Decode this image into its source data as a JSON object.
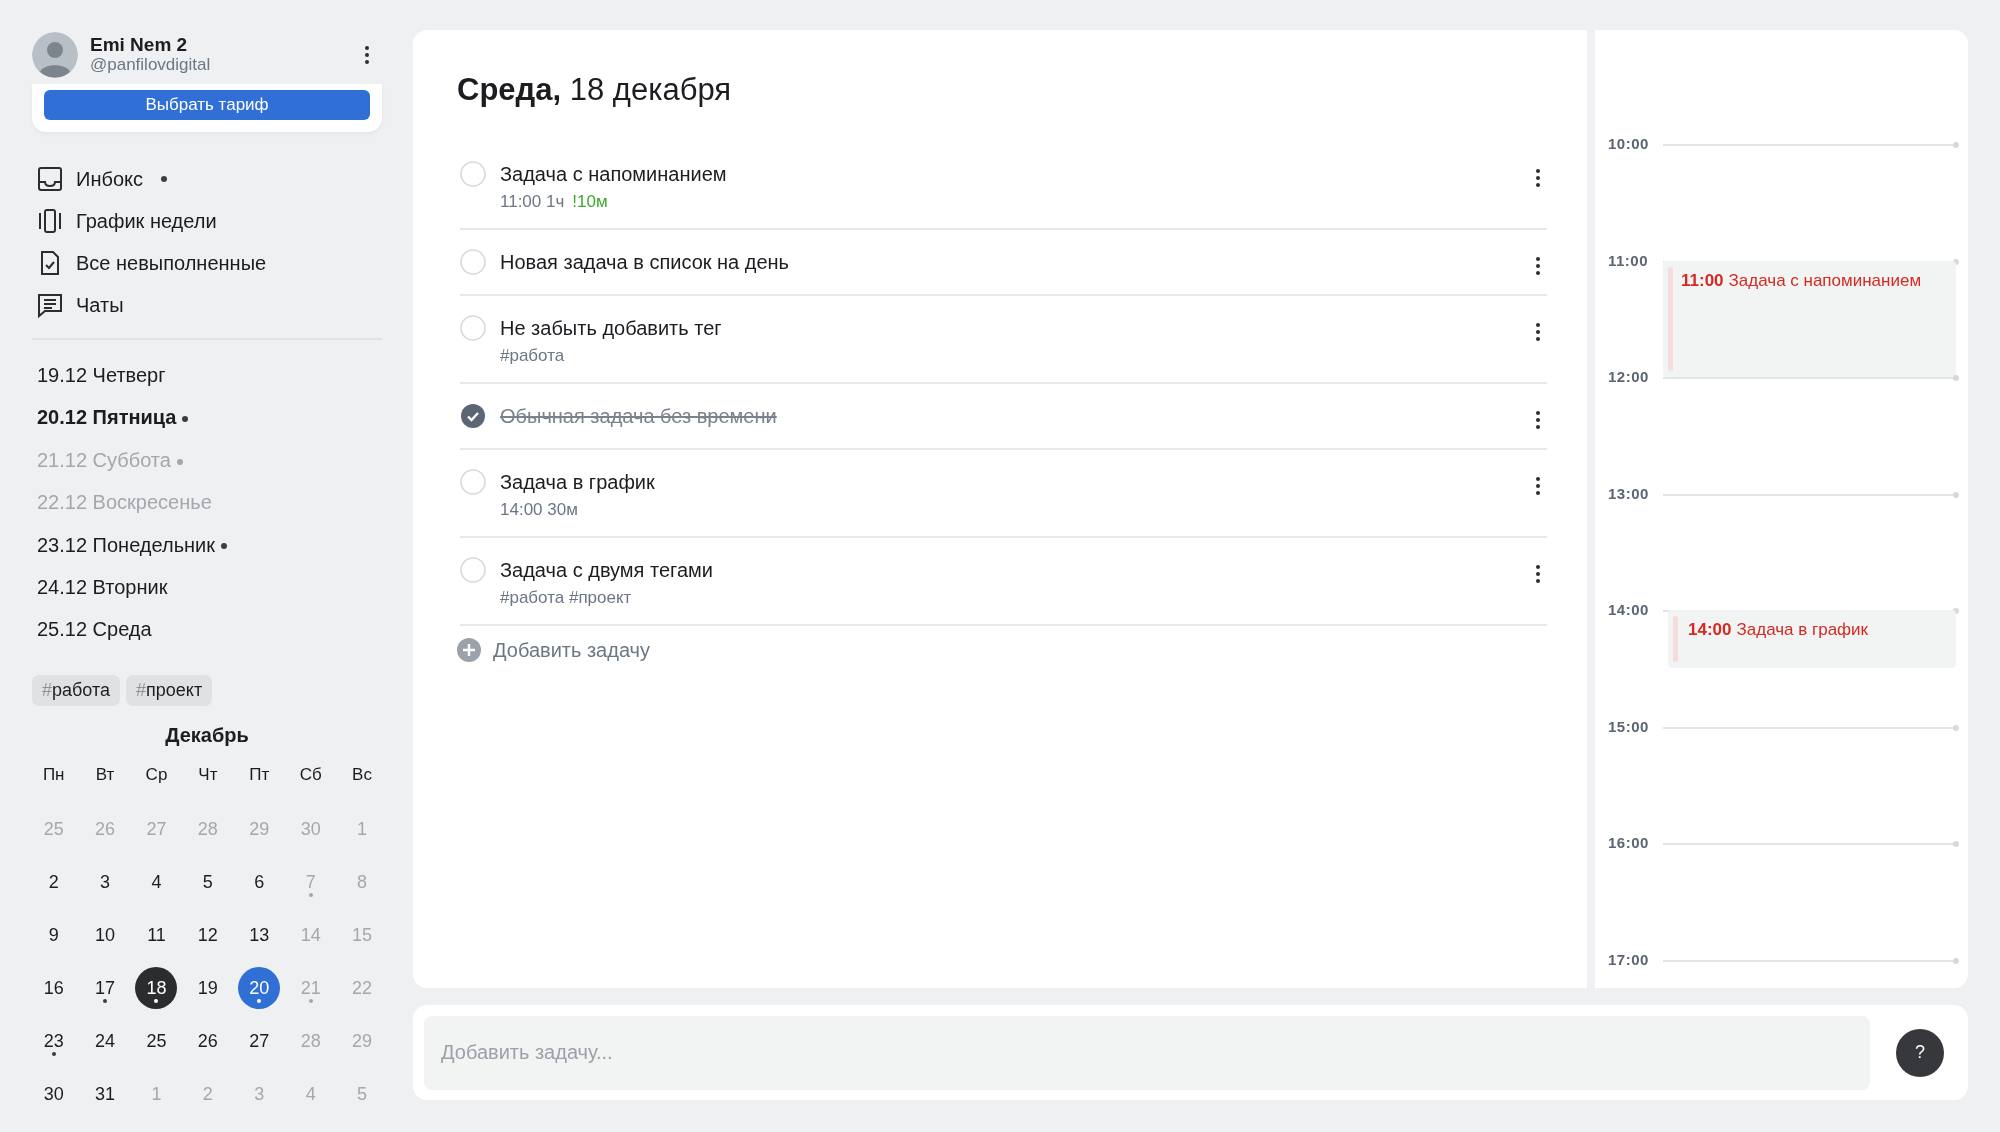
{
  "user": {
    "name": "Emi Nem 2",
    "handle": "@panfilovdigital"
  },
  "plan_button": "Выбрать тариф",
  "nav": [
    {
      "label": "Инбокс",
      "kind": "inbox",
      "dot": true
    },
    {
      "label": "График недели",
      "kind": "week",
      "dot": false
    },
    {
      "label": "Все невыполненные",
      "kind": "todo",
      "dot": false
    },
    {
      "label": "Чаты",
      "kind": "chat",
      "dot": false
    }
  ],
  "days": [
    {
      "label": "19.12 Четверг",
      "selected": false,
      "muted": false,
      "dot": false
    },
    {
      "label": "20.12 Пятница",
      "selected": true,
      "muted": false,
      "dot": true
    },
    {
      "label": "21.12 Суббота",
      "selected": false,
      "muted": true,
      "dot": true
    },
    {
      "label": "22.12 Воскресенье",
      "selected": false,
      "muted": true,
      "dot": false
    },
    {
      "label": "23.12 Понедельник",
      "selected": false,
      "muted": false,
      "dot": true
    },
    {
      "label": "24.12 Вторник",
      "selected": false,
      "muted": false,
      "dot": false
    },
    {
      "label": "25.12 Среда",
      "selected": false,
      "muted": false,
      "dot": false
    }
  ],
  "tags": [
    {
      "symbol": "#",
      "label": "работа"
    },
    {
      "symbol": "#",
      "label": "проект"
    }
  ],
  "calendar": {
    "month": "Декабрь",
    "weekdays": [
      "Пн",
      "Вт",
      "Ср",
      "Чт",
      "Пт",
      "Сб",
      "Вс"
    ],
    "weeks": [
      [
        {
          "day": "25",
          "muted": true,
          "dot": false,
          "today": false,
          "selected": false
        },
        {
          "day": "26",
          "muted": true,
          "dot": false,
          "today": false,
          "selected": false
        },
        {
          "day": "27",
          "muted": true,
          "dot": false,
          "today": false,
          "selected": false
        },
        {
          "day": "28",
          "muted": true,
          "dot": false,
          "today": false,
          "selected": false
        },
        {
          "day": "29",
          "muted": true,
          "dot": false,
          "today": false,
          "selected": false
        },
        {
          "day": "30",
          "muted": true,
          "dot": false,
          "today": false,
          "selected": false
        },
        {
          "day": "1",
          "muted": true,
          "dot": false,
          "today": false,
          "selected": false
        }
      ],
      [
        {
          "day": "2",
          "muted": false,
          "dot": false,
          "today": false,
          "selected": false
        },
        {
          "day": "3",
          "muted": false,
          "dot": false,
          "today": false,
          "selected": false
        },
        {
          "day": "4",
          "muted": false,
          "dot": false,
          "today": false,
          "selected": false
        },
        {
          "day": "5",
          "muted": false,
          "dot": false,
          "today": false,
          "selected": false
        },
        {
          "day": "6",
          "muted": false,
          "dot": false,
          "today": false,
          "selected": false
        },
        {
          "day": "7",
          "muted": true,
          "dot": true,
          "today": false,
          "selected": false
        },
        {
          "day": "8",
          "muted": true,
          "dot": false,
          "today": false,
          "selected": false
        }
      ],
      [
        {
          "day": "9",
          "muted": false,
          "dot": false,
          "today": false,
          "selected": false
        },
        {
          "day": "10",
          "muted": false,
          "dot": false,
          "today": false,
          "selected": false
        },
        {
          "day": "11",
          "muted": false,
          "dot": false,
          "today": false,
          "selected": false
        },
        {
          "day": "12",
          "muted": false,
          "dot": false,
          "today": false,
          "selected": false
        },
        {
          "day": "13",
          "muted": false,
          "dot": false,
          "today": false,
          "selected": false
        },
        {
          "day": "14",
          "muted": true,
          "dot": false,
          "today": false,
          "selected": false
        },
        {
          "day": "15",
          "muted": true,
          "dot": false,
          "today": false,
          "selected": false
        }
      ],
      [
        {
          "day": "16",
          "muted": false,
          "dot": false,
          "today": false,
          "selected": false
        },
        {
          "day": "17",
          "muted": false,
          "dot": true,
          "today": false,
          "selected": false
        },
        {
          "day": "18",
          "muted": false,
          "dot": true,
          "today": true,
          "selected": false
        },
        {
          "day": "19",
          "muted": false,
          "dot": false,
          "today": false,
          "selected": false
        },
        {
          "day": "20",
          "muted": false,
          "dot": true,
          "today": false,
          "selected": true
        },
        {
          "day": "21",
          "muted": true,
          "dot": true,
          "today": false,
          "selected": false
        },
        {
          "day": "22",
          "muted": true,
          "dot": false,
          "today": false,
          "selected": false
        }
      ],
      [
        {
          "day": "23",
          "muted": false,
          "dot": true,
          "today": false,
          "selected": false
        },
        {
          "day": "24",
          "muted": false,
          "dot": false,
          "today": false,
          "selected": false
        },
        {
          "day": "25",
          "muted": false,
          "dot": false,
          "today": false,
          "selected": false
        },
        {
          "day": "26",
          "muted": false,
          "dot": false,
          "today": false,
          "selected": false
        },
        {
          "day": "27",
          "muted": false,
          "dot": false,
          "today": false,
          "selected": false
        },
        {
          "day": "28",
          "muted": true,
          "dot": false,
          "today": false,
          "selected": false
        },
        {
          "day": "29",
          "muted": true,
          "dot": false,
          "today": false,
          "selected": false
        }
      ],
      [
        {
          "day": "30",
          "muted": false,
          "dot": false,
          "today": false,
          "selected": false
        },
        {
          "day": "31",
          "muted": false,
          "dot": false,
          "today": false,
          "selected": false
        },
        {
          "day": "1",
          "muted": true,
          "dot": false,
          "today": false,
          "selected": false
        },
        {
          "day": "2",
          "muted": true,
          "dot": false,
          "today": false,
          "selected": false
        },
        {
          "day": "3",
          "muted": true,
          "dot": false,
          "today": false,
          "selected": false
        },
        {
          "day": "4",
          "muted": true,
          "dot": false,
          "today": false,
          "selected": false
        },
        {
          "day": "5",
          "muted": true,
          "dot": false,
          "today": false,
          "selected": false
        }
      ]
    ]
  },
  "title": "**Среда,** 18 декабря",
  "tasks": [
    {
      "title": "Задача с напоминанием",
      "done": false,
      "details": [
        {
          "text": "11:00 1ч",
          "kind": "time"
        },
        {
          "text": "!10м",
          "kind": "reminder"
        }
      ]
    },
    {
      "title": "Новая задача в список на день",
      "done": false
    },
    {
      "title": "Не забыть добавить тег",
      "done": false,
      "details": [
        {
          "text": "#работа",
          "kind": "tag"
        }
      ]
    },
    {
      "title": "Обычная задача без времени",
      "done": true
    },
    {
      "title": "Задача в график",
      "done": false,
      "details": [
        {
          "text": "14:00 30м",
          "kind": "time"
        }
      ]
    },
    {
      "title": "Задача с двумя тегами",
      "done": false,
      "details": [
        {
          "text": "#работа #проект",
          "kind": "tag"
        }
      ]
    }
  ],
  "add_task": "Добавить задачу",
  "timeline": {
    "hours": [
      {
        "label": "10:00"
      },
      {
        "label": "11:00",
        "events": [
          {
            "time": "11:00",
            "title": "Задача с напоминанием",
            "kind": "hour"
          }
        ]
      },
      {
        "label": "12:00"
      },
      {
        "label": "13:00"
      },
      {
        "label": "14:00",
        "events": [
          {
            "time": "14:00",
            "title": "Задача в график",
            "kind": "half"
          }
        ]
      },
      {
        "label": "15:00"
      },
      {
        "label": "16:00"
      },
      {
        "label": "17:00"
      }
    ]
  },
  "quick_add": {
    "placeholder": "Добавить задачу..."
  },
  "help_button": "?"
}
